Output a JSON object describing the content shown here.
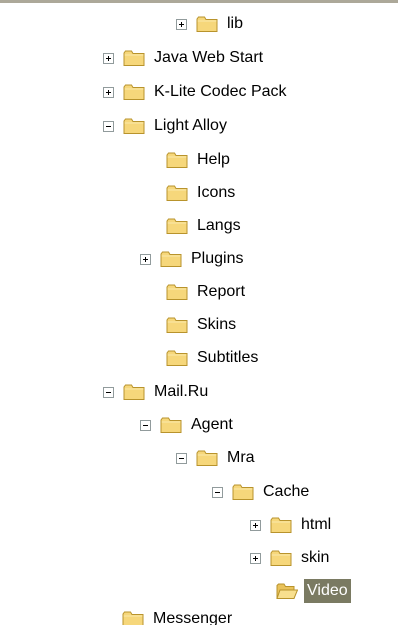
{
  "tree": {
    "items": [
      {
        "label": "lib",
        "expander": "plus",
        "selected": false
      },
      {
        "label": "Java Web Start",
        "expander": "plus",
        "selected": false
      },
      {
        "label": "K-Lite Codec Pack",
        "expander": "plus",
        "selected": false
      },
      {
        "label": "Light Alloy",
        "expander": "minus",
        "selected": false
      },
      {
        "label": "Help",
        "expander": "none",
        "selected": false
      },
      {
        "label": "Icons",
        "expander": "none",
        "selected": false
      },
      {
        "label": "Langs",
        "expander": "none",
        "selected": false
      },
      {
        "label": "Plugins",
        "expander": "plus",
        "selected": false
      },
      {
        "label": "Report",
        "expander": "none",
        "selected": false
      },
      {
        "label": "Skins",
        "expander": "none",
        "selected": false
      },
      {
        "label": "Subtitles",
        "expander": "none",
        "selected": false
      },
      {
        "label": "Mail.Ru",
        "expander": "minus",
        "selected": false
      },
      {
        "label": "Agent",
        "expander": "minus",
        "selected": false
      },
      {
        "label": "Mra",
        "expander": "minus",
        "selected": false
      },
      {
        "label": "Cache",
        "expander": "minus",
        "selected": false
      },
      {
        "label": "html",
        "expander": "plus",
        "selected": false
      },
      {
        "label": "skin",
        "expander": "plus",
        "selected": false
      },
      {
        "label": "Video",
        "expander": "none",
        "selected": true,
        "open": true
      },
      {
        "label": "Messenger",
        "expander": "none",
        "selected": false
      }
    ]
  },
  "colors": {
    "folder_fill": "#f6d77b",
    "folder_outline": "#b8932c",
    "selection_bg": "#7a7a62",
    "expander_border": "#919b9c"
  },
  "icons": {
    "folder": "folder-icon",
    "open_folder": "open-folder-icon",
    "expand": "plus-box-icon",
    "collapse": "minus-box-icon"
  }
}
